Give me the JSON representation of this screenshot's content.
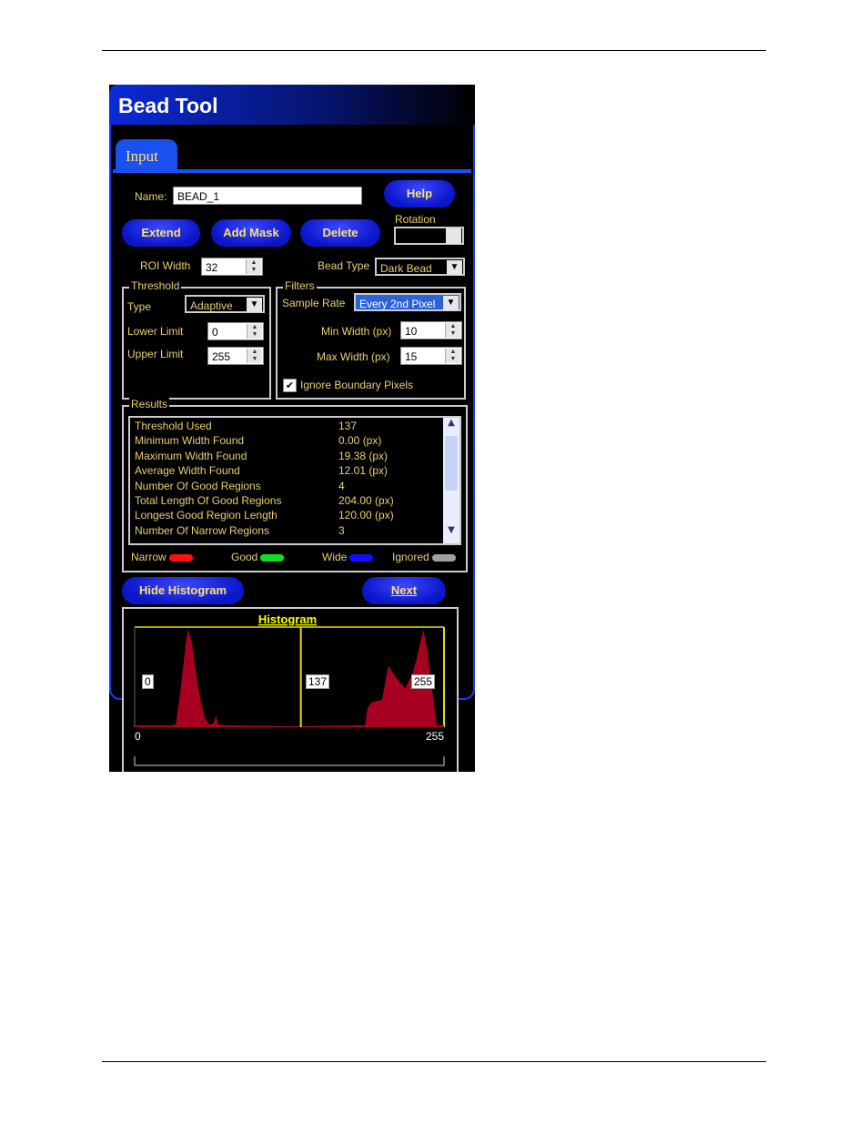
{
  "window": {
    "title": "Bead Tool",
    "tab": "Input"
  },
  "form": {
    "name_label": "Name:",
    "name_value": "BEAD_1",
    "help": "Help",
    "extend": "Extend",
    "add_mask": "Add Mask",
    "delete": "Delete",
    "rotation_label": "Rotation",
    "rotation_value": "",
    "roi_width_label": "ROI Width",
    "roi_width_value": "32",
    "bead_type_label": "Bead Type",
    "bead_type_value": "Dark Bead"
  },
  "threshold": {
    "title": "Threshold",
    "type_label": "Type",
    "type_value": "Adaptive",
    "lower_label": "Lower Limit",
    "lower_value": "0",
    "upper_label": "Upper Limit",
    "upper_value": "255"
  },
  "filters": {
    "title": "Filters",
    "sample_rate_label": "Sample Rate",
    "sample_rate_value": "Every 2nd Pixel",
    "min_label": "Min Width (px)",
    "min_value": "10",
    "max_label": "Max Width (px)",
    "max_value": "15",
    "ignore_label": "Ignore Boundary Pixels",
    "ignore_checked": true
  },
  "results": {
    "title": "Results",
    "rows": [
      {
        "name": "Threshold Used",
        "value": "137"
      },
      {
        "name": "Minimum Width Found",
        "value": "0.00 (px)"
      },
      {
        "name": "Maximum Width Found",
        "value": "19.38 (px)"
      },
      {
        "name": "Average Width Found",
        "value": "12.01 (px)"
      },
      {
        "name": "Number Of Good Regions",
        "value": "4"
      },
      {
        "name": "Total Length Of Good Regions",
        "value": "204.00 (px)"
      },
      {
        "name": "Longest Good Region Length",
        "value": "120.00 (px)"
      },
      {
        "name": "Number Of Narrow Regions",
        "value": "3"
      }
    ]
  },
  "legend": [
    {
      "label": "Narrow",
      "color": "#ff1010"
    },
    {
      "label": "Good",
      "color": "#10e020"
    },
    {
      "label": "Wide",
      "color": "#1010ff"
    },
    {
      "label": "Ignored",
      "color": "#a0a0a0"
    }
  ],
  "buttons": {
    "hide_histogram": "Hide Histogram",
    "next": "Next"
  },
  "chart_data": {
    "type": "area",
    "title": "Histogram",
    "xlim": [
      0,
      255
    ],
    "tick_labels": [
      "0",
      "255"
    ],
    "markers": {
      "lower": "0",
      "threshold": "137",
      "upper": "255"
    },
    "threshold_value": 137,
    "fill_color": "#a80020",
    "line_color": "#e8e000",
    "points": [
      [
        0,
        2
      ],
      [
        30,
        2
      ],
      [
        34,
        3
      ],
      [
        38,
        40
      ],
      [
        42,
        85
      ],
      [
        44,
        100
      ],
      [
        47,
        88
      ],
      [
        50,
        60
      ],
      [
        54,
        30
      ],
      [
        58,
        8
      ],
      [
        62,
        3
      ],
      [
        65,
        4
      ],
      [
        67,
        12
      ],
      [
        69,
        3
      ],
      [
        75,
        2
      ],
      [
        130,
        1
      ],
      [
        190,
        2
      ],
      [
        192,
        20
      ],
      [
        196,
        26
      ],
      [
        204,
        28
      ],
      [
        209,
        63
      ],
      [
        216,
        50
      ],
      [
        223,
        40
      ],
      [
        229,
        55
      ],
      [
        232,
        68
      ],
      [
        236,
        90
      ],
      [
        238,
        100
      ],
      [
        241,
        80
      ],
      [
        245,
        40
      ],
      [
        249,
        2
      ],
      [
        255,
        2
      ]
    ]
  }
}
